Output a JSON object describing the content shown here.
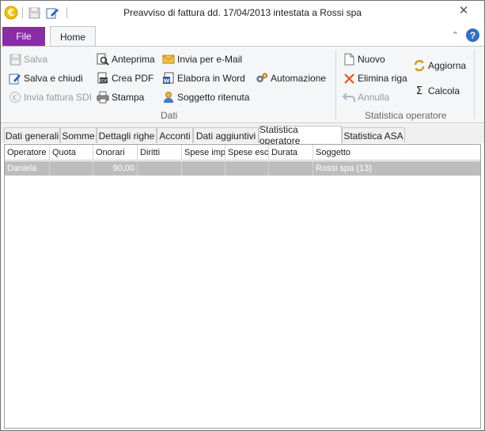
{
  "window": {
    "title": "Preavviso di fattura dd. 17/04/2013 intestata a Rossi spa",
    "close_glyph": "✕"
  },
  "ribbon_tabs": {
    "file": "File",
    "home": "Home",
    "help_glyph": "?",
    "collapse_glyph": "⌃"
  },
  "ribbon": {
    "dati": {
      "label": "Dati",
      "salva": "Salva",
      "salva_chiudi": "Salva e chiudi",
      "invia_sdi": "Invia fattura SDI",
      "anteprima": "Anteprima",
      "crea_pdf": "Crea PDF",
      "stampa": "Stampa",
      "invia_email": "Invia per e-Mail",
      "elabora_word": "Elabora in Word",
      "soggetto_ritenuta": "Soggetto ritenuta",
      "automazione": "Automazione"
    },
    "statistica": {
      "label": "Statistica operatore",
      "nuovo": "Nuovo",
      "elimina_riga": "Elimina riga",
      "annulla": "Annulla",
      "aggiorna": "Aggiorna",
      "calcola": "Calcola"
    }
  },
  "tabs": [
    {
      "label": "Dati generali"
    },
    {
      "label": "Somme"
    },
    {
      "label": "Dettagli righe"
    },
    {
      "label": "Acconti"
    },
    {
      "label": "Dati aggiuntivi"
    },
    {
      "label": "Statistica operatore"
    },
    {
      "label": "Statistica ASA"
    }
  ],
  "grid": {
    "columns": [
      "Operatore",
      "Quota",
      "Onorari",
      "Diritti",
      "Spese impo",
      "Spese escl",
      "Durata",
      "Soggetto"
    ],
    "rows": [
      {
        "operatore": "Daniela",
        "quota": "",
        "onorari": "90,00",
        "diritti": "",
        "spese_imp": "",
        "spese_escl": "",
        "durata": "",
        "soggetto": "Rossi spa (13)"
      }
    ]
  }
}
